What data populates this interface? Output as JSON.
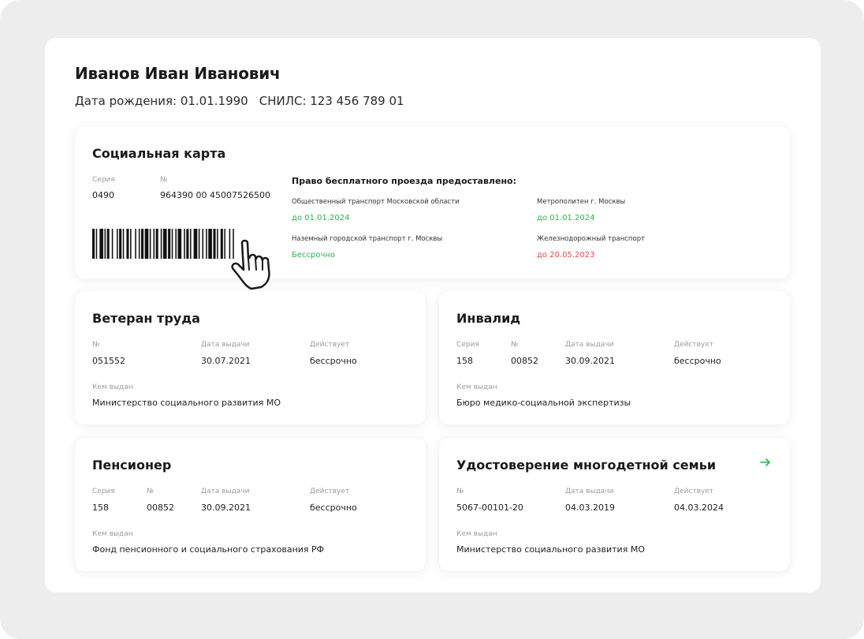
{
  "person": {
    "name": "Иванов Иван Иванович",
    "birth": "Дата рождения: 01.01.1990",
    "snils": "СНИЛС: 123 456 789 01"
  },
  "colors": {
    "green": "#2bb34a",
    "red": "#e5484d",
    "accent_arrow": "#2bb34a"
  },
  "social_card": {
    "title": "Социальная карта",
    "series_label": "Серия",
    "series": "0490",
    "number_label": "№",
    "number": "964390 00 45007526500",
    "barcode_icon": "barcode-icon",
    "cursor_icon": "hand-pointer-icon",
    "rights_title": "Право бесплатного проезда предоставлено:",
    "rights": [
      {
        "name": "Общественный транспорт Московской области",
        "until": "до 01.01.2024",
        "status": "green"
      },
      {
        "name": "Метрополитен г. Москвы",
        "until": "до 01.01.2024",
        "status": "green"
      },
      {
        "name": "Наземный городской транспорт г. Москвы",
        "until": "Бессрочно",
        "status": "green"
      },
      {
        "name": "Железнодорожный транспорт",
        "until": "до 20.05.2023",
        "status": "red"
      }
    ]
  },
  "veteran": {
    "title": "Ветеран труда",
    "number_label": "№",
    "number": "051552",
    "issued_label": "Дата выдачи",
    "issued": "30.07.2021",
    "valid_label": "Действует",
    "valid": "бессрочно",
    "by_label": "Кем выдан",
    "by": "Министерство социального развития МО"
  },
  "disabled": {
    "title": "Инвалид",
    "series_label": "Серия",
    "series": "158",
    "number_label": "№",
    "number": "00852",
    "issued_label": "Дата выдачи",
    "issued": "30.09.2021",
    "valid_label": "Действует",
    "valid": "бессрочно",
    "by_label": "Кем выдан",
    "by": "Бюро медико-социальной экспертизы"
  },
  "pensioner": {
    "title": "Пенсионер",
    "series_label": "Серия",
    "series": "158",
    "number_label": "№",
    "number": "00852",
    "issued_label": "Дата выдачи",
    "issued": "30.09.2021",
    "valid_label": "Действует",
    "valid": "бессрочно",
    "by_label": "Кем выдан",
    "by": "Фонд пенсионного и социального страхования РФ"
  },
  "large_family": {
    "title": "Удостоверение многодетной семьи",
    "arrow_icon": "arrow-right-icon",
    "number_label": "№",
    "number": "5067-00101-20",
    "issued_label": "Дата выдачи",
    "issued": "04.03.2019",
    "valid_label": "Действует",
    "valid": "04.03.2024",
    "by_label": "Кем выдан",
    "by": "Министерство социального развития МО"
  }
}
